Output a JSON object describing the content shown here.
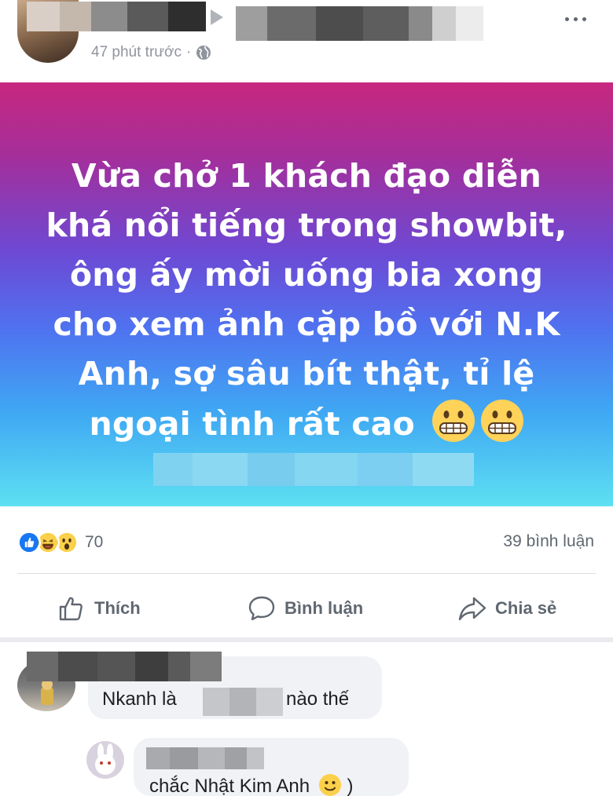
{
  "post": {
    "timestamp": "47 phút trước",
    "separator": "·",
    "text_lines": [
      "Vừa chở 1 khách đạo diễn",
      "khá nổi tiếng trong showbit,",
      "ông ấy mời uống bia xong",
      "cho xem ảnh cặp bồ với  N.K",
      "Anh, sợ sâu bít thật, tỉ lệ",
      "ngoại tình rất cao"
    ],
    "emojis": [
      "grimacing-face",
      "grimacing-face"
    ],
    "background": {
      "top": "#c7277f",
      "middle": "#6d49d4",
      "bottom": "#5ee0f2"
    }
  },
  "stats": {
    "reactions": [
      "like",
      "haha",
      "wow"
    ],
    "reaction_count": "70",
    "comment_count": "39 bình luận"
  },
  "actions": {
    "like_label": "Thích",
    "comment_label": "Bình luận",
    "share_label": "Chia sẻ"
  },
  "comments": [
    {
      "text_before": "Nkanh là",
      "text_after": "nào thế"
    },
    {
      "text": "chắc Nhật Kim Anh",
      "suffix": ")"
    }
  ],
  "colors": {
    "like_blue": "#1877f2",
    "text_gray": "#606770",
    "bubble_gray": "#f0f2f5"
  }
}
